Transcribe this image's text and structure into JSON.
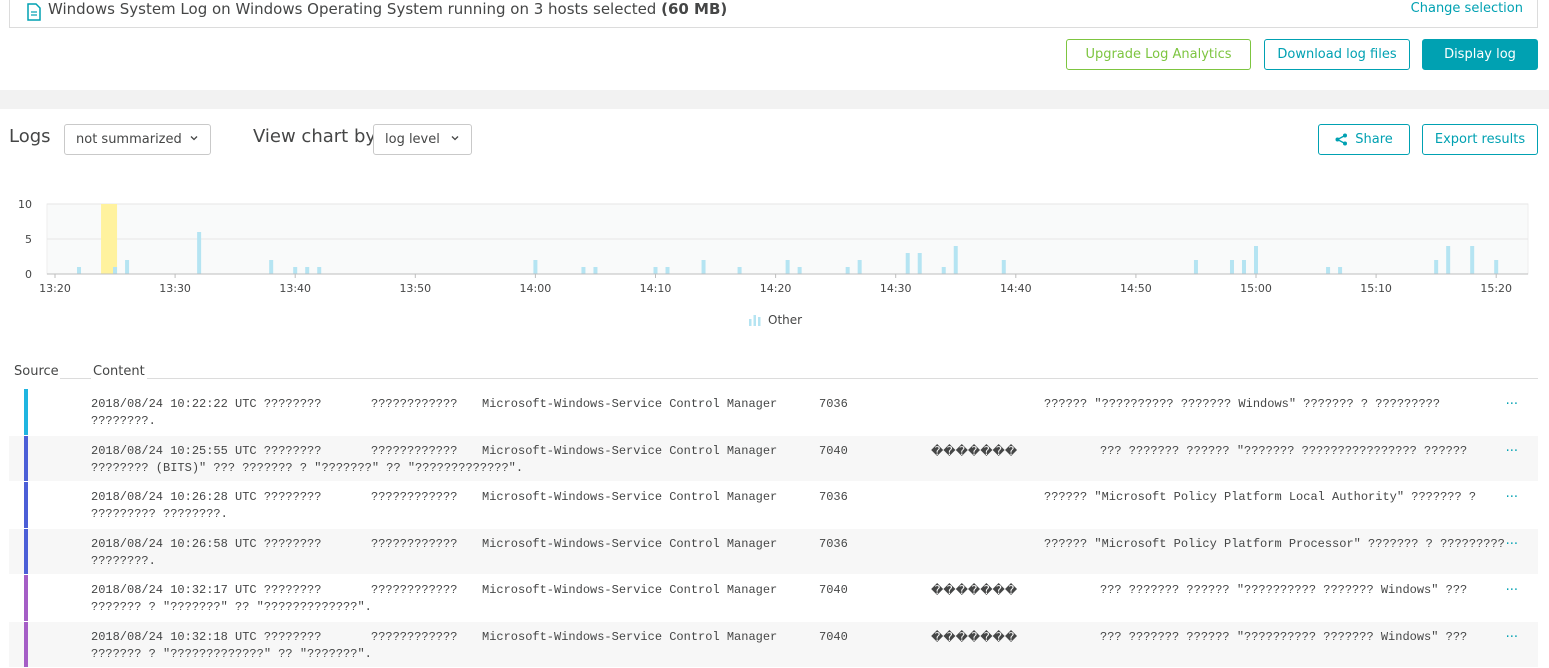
{
  "selection": {
    "text": "Windows System Log on Windows Operating System running on 3 hosts selected ",
    "size": "(60 MB)",
    "change_label": "Change selection"
  },
  "actions": {
    "upgrade": "Upgrade Log Analytics",
    "download": "Download log files",
    "display": "Display log"
  },
  "controls": {
    "logs_title": "Logs",
    "summary_value": "not summarized",
    "viewby_label": "View chart by",
    "level_value": "log level",
    "share": "Share",
    "export": "Export results"
  },
  "colors": {
    "accent": "#00a1b2",
    "upgrade": "#7dc540",
    "bar": "#b5e4f2",
    "highlight": "#fff29e"
  },
  "chart_data": {
    "type": "bar",
    "x_ticks": [
      "13:20",
      "13:30",
      "13:40",
      "13:50",
      "14:00",
      "14:10",
      "14:20",
      "14:30",
      "14:40",
      "14:50",
      "15:00",
      "15:10",
      "15:20"
    ],
    "y_ticks": [
      "10",
      "5",
      "0"
    ],
    "ylim": [
      0,
      10
    ],
    "highlight_range": [
      "13:24",
      "13:25"
    ],
    "series": [
      {
        "name": "Other",
        "points": [
          {
            "t": "13:22",
            "v": 1
          },
          {
            "t": "13:25",
            "v": 1
          },
          {
            "t": "13:26",
            "v": 2
          },
          {
            "t": "13:32",
            "v": 6
          },
          {
            "t": "13:38",
            "v": 2
          },
          {
            "t": "13:40",
            "v": 1
          },
          {
            "t": "13:41",
            "v": 1
          },
          {
            "t": "13:42",
            "v": 1
          },
          {
            "t": "14:00",
            "v": 2
          },
          {
            "t": "14:04",
            "v": 1
          },
          {
            "t": "14:05",
            "v": 1
          },
          {
            "t": "14:10",
            "v": 1
          },
          {
            "t": "14:11",
            "v": 1
          },
          {
            "t": "14:14",
            "v": 2
          },
          {
            "t": "14:17",
            "v": 1
          },
          {
            "t": "14:21",
            "v": 2
          },
          {
            "t": "14:22",
            "v": 1
          },
          {
            "t": "14:26",
            "v": 1
          },
          {
            "t": "14:27",
            "v": 2
          },
          {
            "t": "14:31",
            "v": 3
          },
          {
            "t": "14:32",
            "v": 3
          },
          {
            "t": "14:34",
            "v": 1
          },
          {
            "t": "14:35",
            "v": 4
          },
          {
            "t": "14:39",
            "v": 2
          },
          {
            "t": "14:55",
            "v": 2
          },
          {
            "t": "14:58",
            "v": 2
          },
          {
            "t": "14:59",
            "v": 2
          },
          {
            "t": "15:00",
            "v": 4
          },
          {
            "t": "15:06",
            "v": 1
          },
          {
            "t": "15:07",
            "v": 1
          },
          {
            "t": "15:15",
            "v": 2
          },
          {
            "t": "15:16",
            "v": 4
          },
          {
            "t": "15:18",
            "v": 4
          },
          {
            "t": "15:20",
            "v": 2
          }
        ]
      }
    ],
    "legend": "Other"
  },
  "table": {
    "headers": {
      "source": "Source",
      "content": "Content"
    },
    "more": "···",
    "rows": [
      {
        "color": "#1fb5e0",
        "ts": "2018/08/24 10:22:22 UTC ????????",
        "a": "????????????",
        "src": "Microsoft-Windows-Service Control Manager",
        "id": "7036",
        "cat": "",
        "msg": "?????? \"?????????? ??????? Windows\" ??????? ? ?????????",
        "line2": "????????."
      },
      {
        "color": "#4c5fd7",
        "ts": "2018/08/24 10:25:55 UTC ????????",
        "a": "????????????",
        "src": "Microsoft-Windows-Service Control Manager",
        "id": "7040",
        "cat": "�������",
        "msg": "??? ??????? ?????? \"??????? ???????????????? ??????",
        "line2": "???????? (BITS)\" ??? ??????? ? \"???????\" ?? \"?????????????\"."
      },
      {
        "color": "#4c5fd7",
        "ts": "2018/08/24 10:26:28 UTC ????????",
        "a": "????????????",
        "src": "Microsoft-Windows-Service Control Manager",
        "id": "7036",
        "cat": "",
        "msg": "?????? \"Microsoft Policy Platform Local Authority\" ??????? ?",
        "line2": "????????? ????????."
      },
      {
        "color": "#4c5fd7",
        "ts": "2018/08/24 10:26:58 UTC ????????",
        "a": "????????????",
        "src": "Microsoft-Windows-Service Control Manager",
        "id": "7036",
        "cat": "",
        "msg": "?????? \"Microsoft Policy Platform Processor\" ??????? ? ?????????",
        "line2": "????????."
      },
      {
        "color": "#a55ec6",
        "ts": "2018/08/24 10:32:17 UTC ????????",
        "a": "????????????",
        "src": "Microsoft-Windows-Service Control Manager",
        "id": "7040",
        "cat": "�������",
        "msg": "??? ??????? ?????? \"?????????? ??????? Windows\" ???",
        "line2": "??????? ? \"???????\" ?? \"?????????????\"."
      },
      {
        "color": "#a55ec6",
        "ts": "2018/08/24 10:32:18 UTC ????????",
        "a": "????????????",
        "src": "Microsoft-Windows-Service Control Manager",
        "id": "7040",
        "cat": "�������",
        "msg": "??? ??????? ?????? \"?????????? ??????? Windows\" ???",
        "line2": "??????? ? \"?????????????\" ?? \"???????\"."
      }
    ]
  }
}
